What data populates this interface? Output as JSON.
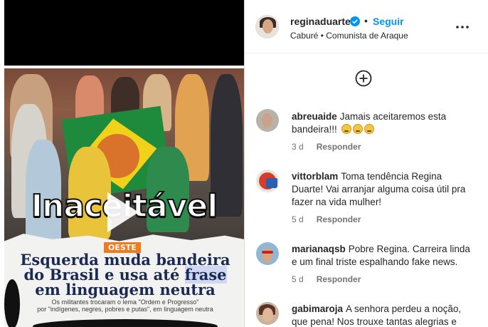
{
  "post": {
    "headline": "Inaceitável",
    "brand": "OESTE",
    "subheadline_line1": "Esquerda muda bandeira",
    "subheadline_line2_pre": "do Brasil e usa até ",
    "subheadline_line2_hl": "frase",
    "subheadline_line3": "em linguagem neutra",
    "caption_line1": "Os militantes trocaram o lema \"Ordem e Progresso\"",
    "caption_line2": "por \"indígenes, negres, pobres e putas\", em linguagem neutra"
  },
  "header": {
    "username": "reginaduarte",
    "separator": "•",
    "follow_label": "Seguir",
    "subtitle": "Caburé • Comunista de Araque"
  },
  "comments": [
    {
      "user": "abreuaide",
      "line1": "Jamais aceitaremos esta",
      "line2": "bandeira!!!",
      "emoji_count": 3,
      "time": "3 d",
      "reply": "Responder"
    },
    {
      "user": "vittorblam",
      "line1": "Toma tendência Regina",
      "line2": "Duarte! Vai arranjar alguma coisa útil pra",
      "line3": "fazer na vida mulher!",
      "time": "5 d",
      "reply": "Responder"
    },
    {
      "user": "marianaqsb",
      "line1": "Pobre Regina. Carreira linda",
      "line2": "e um final triste espalhando fake news.",
      "time": "5 d",
      "reply": "Responder"
    },
    {
      "user": "gabimaroja",
      "line1": "A senhora perdeu a noção,",
      "line2": "que pena! Nos trouxe tantas alegrias e"
    }
  ],
  "colors": {
    "accent": "#0095f6",
    "verified": "#0095f6",
    "muted": "#737373",
    "brand": "#f07b1e"
  },
  "icons": {
    "verified": "verified-badge-icon",
    "more": "more-options-icon",
    "add": "add-circle-icon",
    "play": "play-icon"
  }
}
